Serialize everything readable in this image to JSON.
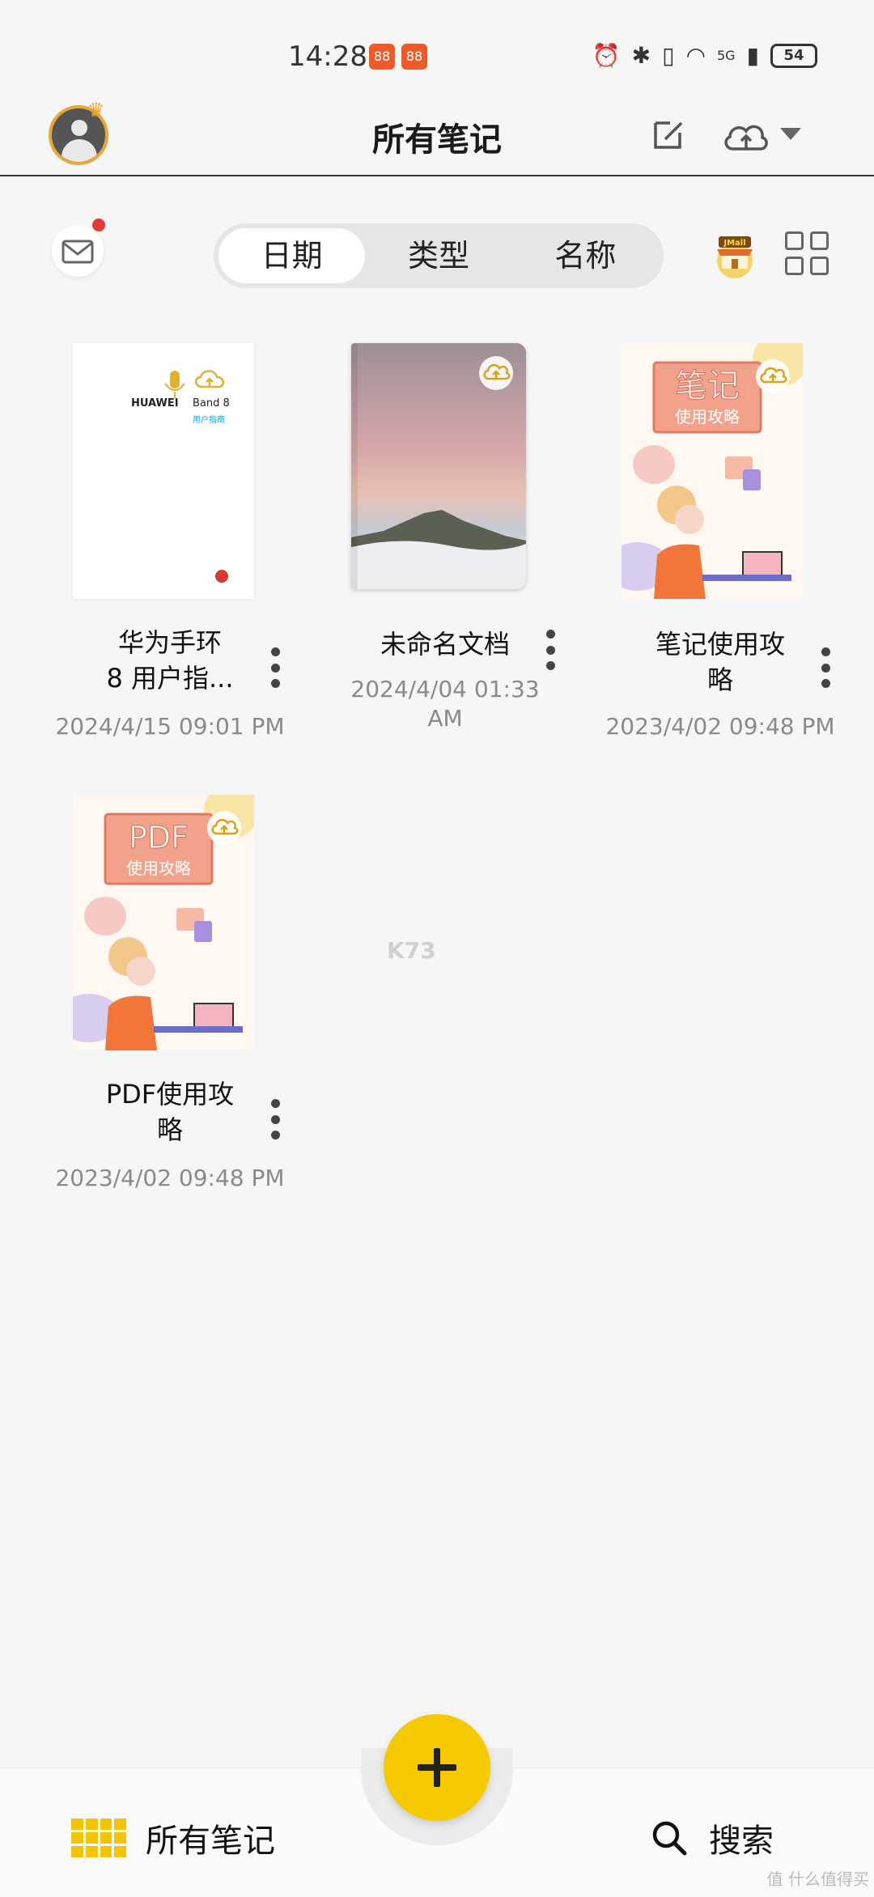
{
  "status_bar": {
    "time": "14:28",
    "app_badge_1": "88",
    "app_badge_2": "88",
    "network": "5G",
    "battery": "54"
  },
  "header": {
    "title": "所有笔记"
  },
  "filter": {
    "tabs": [
      {
        "label": "日期",
        "active": true
      },
      {
        "label": "类型",
        "active": false
      },
      {
        "label": "名称",
        "active": false
      }
    ],
    "store_label": "JMall"
  },
  "notes": [
    {
      "title": "华为手环8 用户指...",
      "title_line1": "华为手环",
      "title_line2": "8 用户指...",
      "date": "2024/4/15 09:01 PM",
      "cover": "huawei-band-guide",
      "cover_brand": "HUAWEI",
      "cover_model": "Band 8",
      "cover_sub": "用户指南"
    },
    {
      "title": "未命名文档",
      "date_line1": "2024/4/04 01:33",
      "date_line2": "AM",
      "cover": "mountain-sunset"
    },
    {
      "title_line1": "笔记使用攻",
      "title_line2": "略",
      "date": "2023/4/02 09:48 PM",
      "cover": "notes-guide",
      "cover_word1": "笔记",
      "cover_word2": "使用攻略"
    },
    {
      "title_line1": "PDF使用攻",
      "title_line2": "略",
      "date": "2023/4/02 09:48 PM",
      "cover": "pdf-guide",
      "cover_word1": "PDF",
      "cover_word2": "使用攻略"
    }
  ],
  "watermark": "K73",
  "bottom_nav": {
    "all_notes": "所有笔记",
    "search": "搜索"
  },
  "corner_watermark": "值 什么值得买",
  "colors": {
    "accent_yellow": "#f5c900",
    "background": "#f6f6f6",
    "notification_red": "#e53935"
  }
}
